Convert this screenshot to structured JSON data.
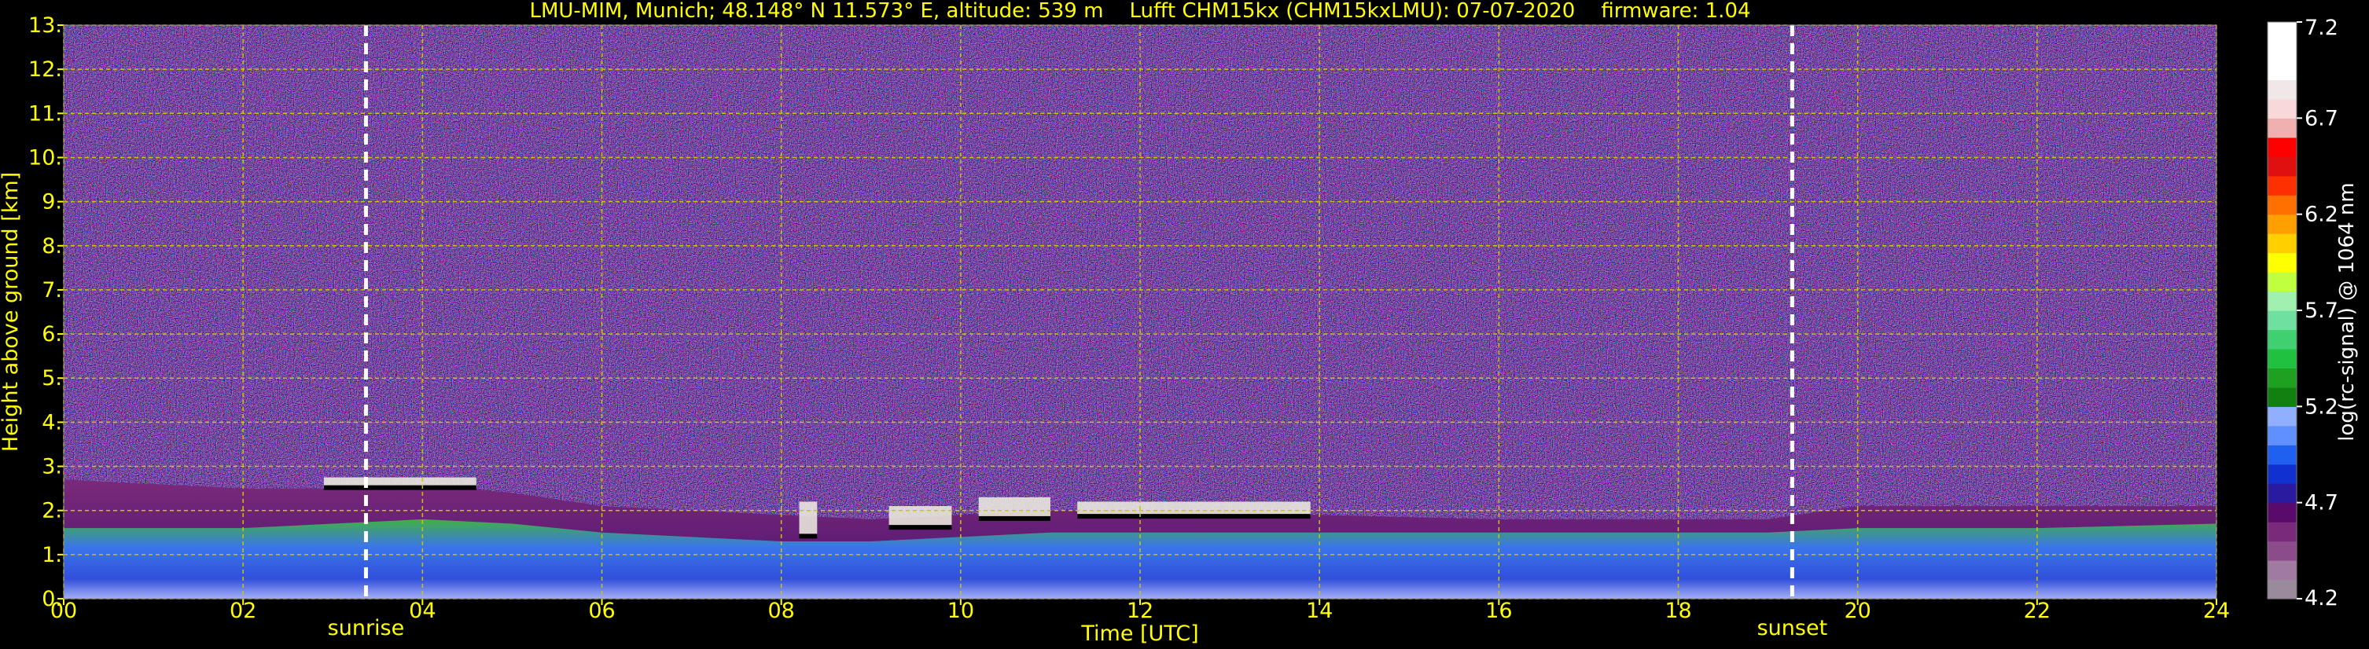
{
  "chart_data": {
    "type": "heatmap",
    "title": "LMU-MIM, Munich; 48.148° N 11.573° E, altitude: 539 m    Lufft CHM15kx (CHM15kxLMU): 07-07-2020    firmware: 1.04",
    "xlabel": "Time [UTC]",
    "ylabel": "Height above ground [km]",
    "xlim": [
      0,
      24
    ],
    "ylim": [
      0,
      13
    ],
    "x_ticks": [
      "00",
      "02",
      "04",
      "06",
      "08",
      "10",
      "12",
      "14",
      "16",
      "18",
      "20",
      "22",
      "24"
    ],
    "x_tick_values": [
      0,
      2,
      4,
      6,
      8,
      10,
      12,
      14,
      16,
      18,
      20,
      22,
      24
    ],
    "y_ticks": [
      "0.",
      "1.",
      "2.",
      "3.",
      "4.",
      "5.",
      "6.",
      "7.",
      "8.",
      "9.",
      "10.",
      "11.",
      "12.",
      "13."
    ],
    "y_tick_values": [
      0,
      1,
      2,
      3,
      4,
      5,
      6,
      7,
      8,
      9,
      10,
      11,
      12,
      13
    ],
    "grid": true,
    "markers": [
      {
        "label": "sunrise",
        "x": 3.37
      },
      {
        "label": "sunset",
        "x": 19.27
      }
    ],
    "boundary_layer": [
      {
        "x": 0,
        "top": 2.7,
        "core": 1.6
      },
      {
        "x": 1,
        "top": 2.6,
        "core": 1.6
      },
      {
        "x": 2,
        "top": 2.5,
        "core": 1.6
      },
      {
        "x": 3,
        "top": 2.5,
        "core": 1.7
      },
      {
        "x": 4,
        "top": 2.6,
        "core": 1.8
      },
      {
        "x": 5,
        "top": 2.4,
        "core": 1.7
      },
      {
        "x": 6,
        "top": 2.1,
        "core": 1.5
      },
      {
        "x": 7,
        "top": 2.0,
        "core": 1.4
      },
      {
        "x": 8,
        "top": 1.9,
        "core": 1.3
      },
      {
        "x": 9,
        "top": 1.8,
        "core": 1.3
      },
      {
        "x": 10,
        "top": 1.9,
        "core": 1.4
      },
      {
        "x": 11,
        "top": 2.0,
        "core": 1.5
      },
      {
        "x": 12,
        "top": 2.0,
        "core": 1.5
      },
      {
        "x": 13,
        "top": 2.0,
        "core": 1.5
      },
      {
        "x": 14,
        "top": 1.9,
        "core": 1.5
      },
      {
        "x": 16,
        "top": 1.8,
        "core": 1.5
      },
      {
        "x": 18,
        "top": 1.8,
        "core": 1.5
      },
      {
        "x": 19,
        "top": 1.8,
        "core": 1.5
      },
      {
        "x": 20,
        "top": 2.1,
        "core": 1.6
      },
      {
        "x": 22,
        "top": 2.1,
        "core": 1.6
      },
      {
        "x": 24,
        "top": 2.1,
        "core": 1.7
      }
    ],
    "clouds": [
      {
        "x_start": 2.9,
        "x_end": 4.6,
        "base": 2.5,
        "top": 2.75
      },
      {
        "x_start": 8.2,
        "x_end": 8.4,
        "base": 1.4,
        "top": 2.2
      },
      {
        "x_start": 9.2,
        "x_end": 9.9,
        "base": 1.6,
        "top": 2.1
      },
      {
        "x_start": 10.2,
        "x_end": 11.0,
        "base": 1.8,
        "top": 2.3
      },
      {
        "x_start": 11.3,
        "x_end": 13.9,
        "base": 1.85,
        "top": 2.2
      }
    ],
    "colorbar": {
      "label": "log(rc-signal) @ 1064 nm",
      "min": 4.2,
      "max": 7.2,
      "ticks": [
        "4.2",
        "4.7",
        "5.2",
        "5.7",
        "6.2",
        "6.7",
        "7.2"
      ],
      "tick_values": [
        4.2,
        4.7,
        5.2,
        5.7,
        6.2,
        6.7,
        7.2
      ],
      "colors": [
        "#9a8a9c",
        "#a07aa0",
        "#8c4c8c",
        "#7a2a7a",
        "#5a0a6a",
        "#2a1aa0",
        "#1030d0",
        "#2060f0",
        "#6090ff",
        "#90b0ff",
        "#108010",
        "#20a020",
        "#20c040",
        "#40d070",
        "#70e0a0",
        "#a0f0b0",
        "#c0ff40",
        "#ffff00",
        "#ffd000",
        "#ffa000",
        "#ff7000",
        "#ff3000",
        "#e01010",
        "#ff0000",
        "#f0b0b0",
        "#f8d8d8",
        "#f0e8e8",
        "#ffffff",
        "#ffffff",
        "#ffffff"
      ]
    }
  }
}
